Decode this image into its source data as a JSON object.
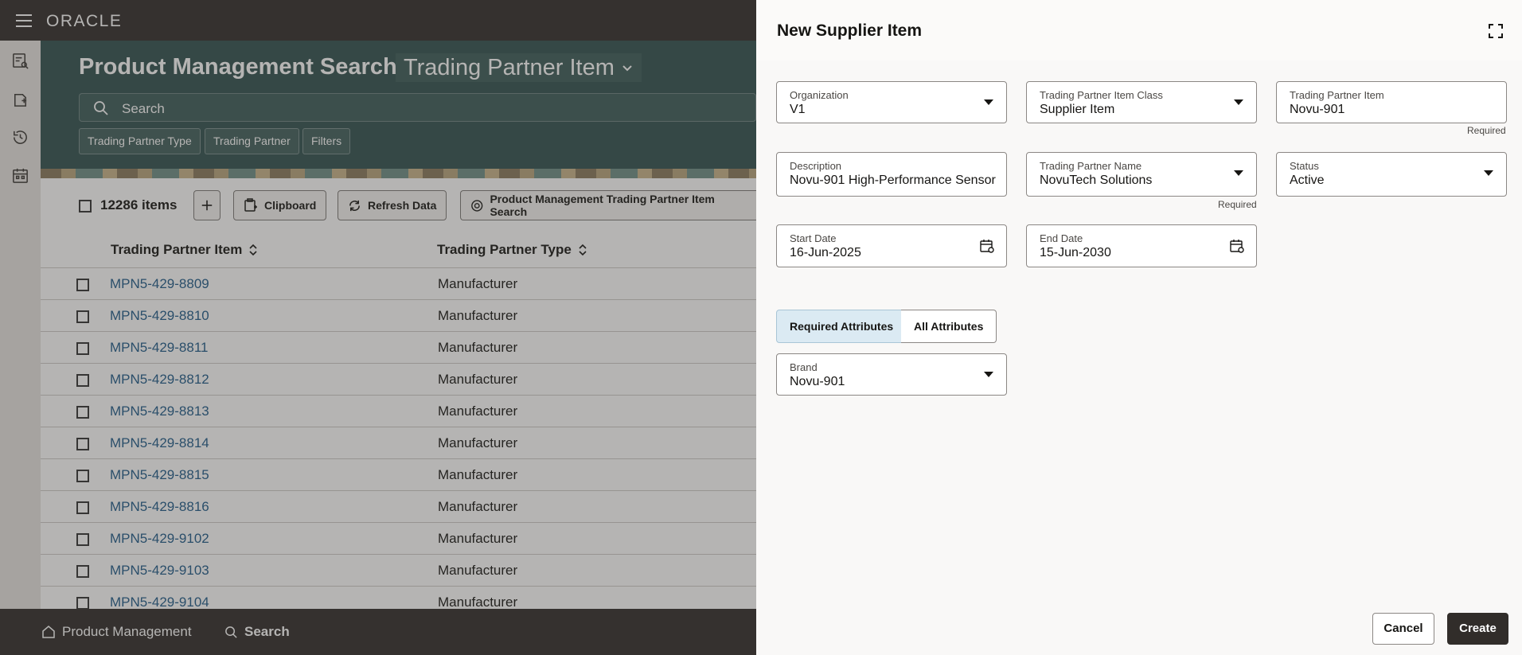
{
  "app": {
    "logo": "ORACLE"
  },
  "page": {
    "title": "Product Management Search",
    "view_selector": "Trading Partner Item",
    "search_placeholder": "Search",
    "filter_chips": [
      "Trading Partner Type",
      "Trading Partner",
      "Filters"
    ]
  },
  "toolbar": {
    "items_count": "12286 items",
    "clipboard_label": "Clipboard",
    "refresh_label": "Refresh Data",
    "saved_search_label": "Product Management Trading Partner Item Search"
  },
  "table": {
    "columns": [
      "Trading Partner Item",
      "Trading Partner Type"
    ],
    "rows": [
      {
        "item": "MPN5-429-8809",
        "type": "Manufacturer"
      },
      {
        "item": "MPN5-429-8810",
        "type": "Manufacturer"
      },
      {
        "item": "MPN5-429-8811",
        "type": "Manufacturer"
      },
      {
        "item": "MPN5-429-8812",
        "type": "Manufacturer"
      },
      {
        "item": "MPN5-429-8813",
        "type": "Manufacturer"
      },
      {
        "item": "MPN5-429-8814",
        "type": "Manufacturer"
      },
      {
        "item": "MPN5-429-8815",
        "type": "Manufacturer"
      },
      {
        "item": "MPN5-429-8816",
        "type": "Manufacturer"
      },
      {
        "item": "MPN5-429-9102",
        "type": "Manufacturer"
      },
      {
        "item": "MPN5-429-9103",
        "type": "Manufacturer"
      },
      {
        "item": "MPN5-429-9104",
        "type": "Manufacturer"
      }
    ]
  },
  "bottom_nav": {
    "home_label": "Product Management",
    "search_label": "Search"
  },
  "drawer": {
    "title": "New Supplier Item",
    "fields": {
      "organization": {
        "label": "Organization",
        "value": "V1"
      },
      "item_class": {
        "label": "Trading Partner Item Class",
        "value": "Supplier Item"
      },
      "tp_item": {
        "label": "Trading Partner Item",
        "value": "Novu-901",
        "note": "Required"
      },
      "description": {
        "label": "Description",
        "value": "Novu-901 High-Performance Sensor"
      },
      "tp_name": {
        "label": "Trading Partner Name",
        "value": "NovuTech Solutions",
        "note": "Required"
      },
      "status": {
        "label": "Status",
        "value": "Active"
      },
      "start_date": {
        "label": "Start Date",
        "value": "16-Jun-2025"
      },
      "end_date": {
        "label": "End Date",
        "value": "15-Jun-2030"
      },
      "brand": {
        "label": "Brand",
        "value": "Novu-901"
      }
    },
    "attribute_tabs": [
      "Required Attributes",
      "All Attributes"
    ],
    "cancel_label": "Cancel",
    "create_label": "Create"
  },
  "colors": {
    "header": "#312d2a",
    "hero": "#31524f",
    "link": "#1f5b8a",
    "accent_tab": "#dbeaf3"
  }
}
